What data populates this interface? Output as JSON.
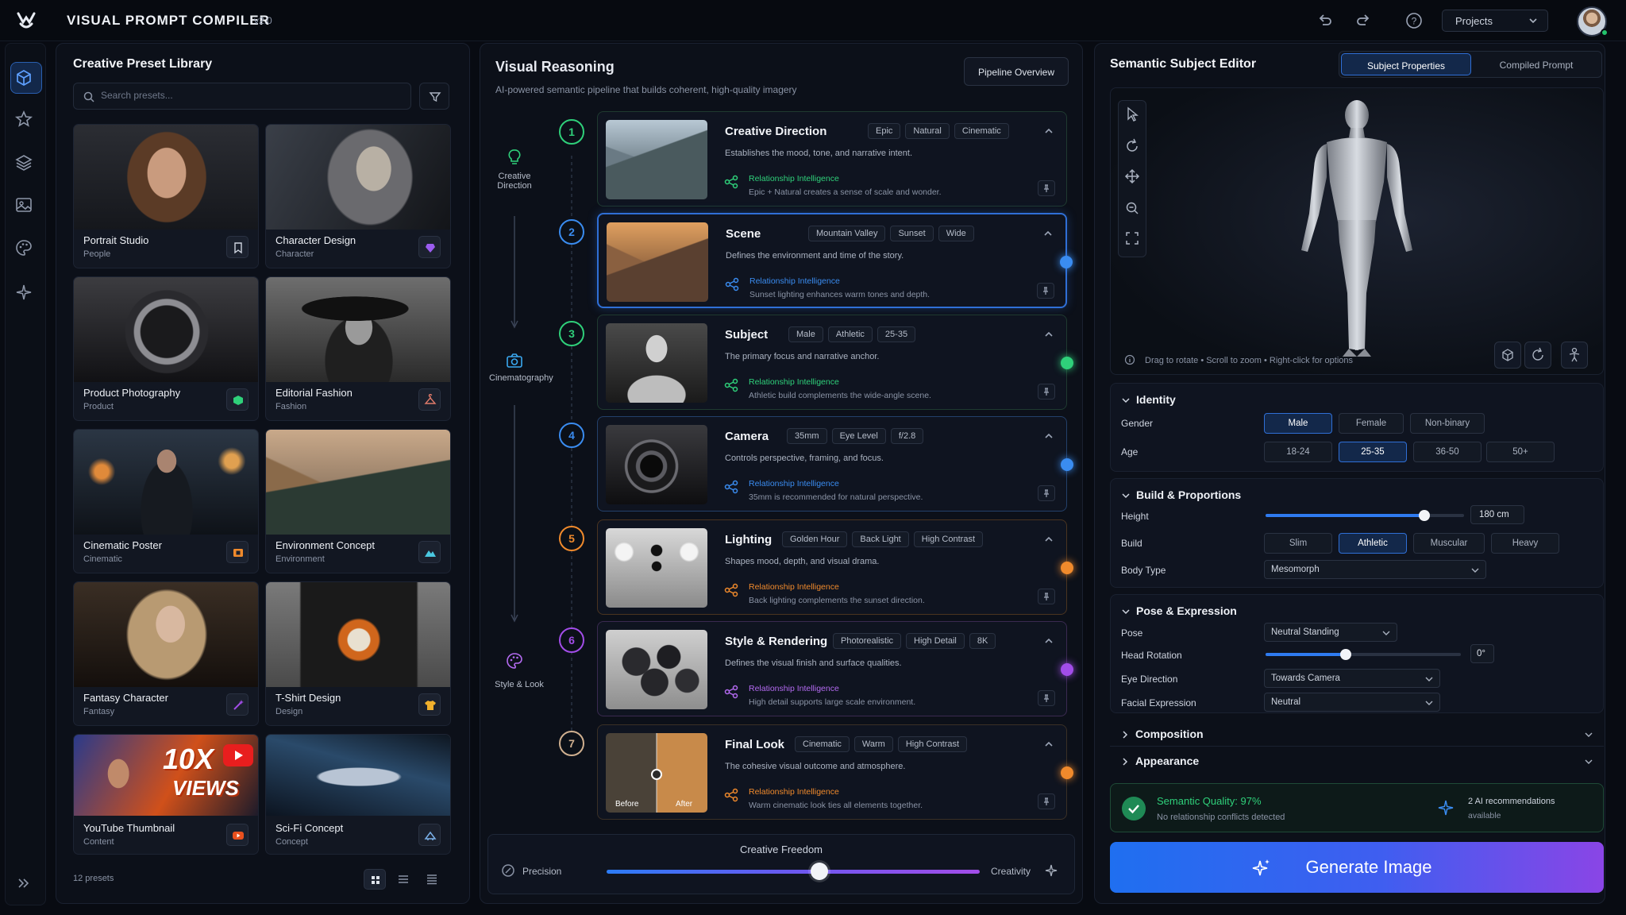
{
  "app": {
    "name": "VISUAL PROMPT COMPILER",
    "version": "v2.0",
    "projects_label": "Projects"
  },
  "icons": {
    "logo": "brand-logo-icon",
    "undo": "undo-icon",
    "redo": "redo-icon",
    "help": "help-icon",
    "sidebar": [
      "cube-icon",
      "star-icon",
      "layers-icon",
      "image-icon",
      "palette-icon",
      "sparkle-icon",
      "expand-icon"
    ]
  },
  "colors": {
    "accent": "#2f7bf0",
    "success": "#23c26b",
    "orange": "#f08a2c",
    "purple": "#a24de8",
    "green": "#2fd07a"
  },
  "library": {
    "title": "Creative Preset Library",
    "search_placeholder": "Search presets...",
    "count": "12 presets",
    "cards": [
      {
        "title": "Portrait Studio",
        "category": "People"
      },
      {
        "title": "Character Design",
        "category": "Character"
      },
      {
        "title": "Product Photography",
        "category": "Product"
      },
      {
        "title": "Editorial Fashion",
        "category": "Fashion"
      },
      {
        "title": "Cinematic Poster",
        "category": "Cinematic"
      },
      {
        "title": "Environment Concept",
        "category": "Environment"
      },
      {
        "title": "Fantasy Character",
        "category": "Fantasy"
      },
      {
        "title": "T-Shirt Design",
        "category": "Design"
      },
      {
        "title": "YouTube Thumbnail",
        "category": "Content"
      },
      {
        "title": "Sci-Fi Concept",
        "category": "Concept"
      }
    ],
    "thumb_text": {
      "line1": "10X",
      "line2": "VIEWS"
    }
  },
  "reasoning": {
    "title": "Visual Reasoning",
    "subtitle": "AI-powered semantic pipeline that builds coherent, high-quality imagery",
    "pipeline_button": "Pipeline Overview",
    "groups": [
      "Creative Direction",
      "Cinematography",
      "Style & Look"
    ],
    "rel_label": "Relationship Intelligence",
    "stages": [
      {
        "num": "1",
        "title": "Creative Direction",
        "chips": [
          "Epic",
          "Natural",
          "Cinematic"
        ],
        "desc": "Establishes the mood, tone, and narrative intent.",
        "rel": "Epic + Natural creates a sense of scale and wonder."
      },
      {
        "num": "2",
        "title": "Scene",
        "chips": [
          "Mountain Valley",
          "Sunset",
          "Wide"
        ],
        "desc": "Defines the environment and time of the story.",
        "rel": "Sunset lighting enhances warm tones and depth."
      },
      {
        "num": "3",
        "title": "Subject",
        "chips": [
          "Male",
          "Athletic",
          "25-35"
        ],
        "desc": "The primary focus and narrative anchor.",
        "rel": "Athletic build complements the wide-angle scene."
      },
      {
        "num": "4",
        "title": "Camera",
        "chips": [
          "35mm",
          "Eye Level",
          "f/2.8"
        ],
        "desc": "Controls perspective, framing, and focus.",
        "rel": "35mm is recommended for natural perspective."
      },
      {
        "num": "5",
        "title": "Lighting",
        "chips": [
          "Golden Hour",
          "Back Light",
          "High Contrast"
        ],
        "desc": "Shapes mood, depth, and visual drama.",
        "rel": "Back lighting complements the sunset direction."
      },
      {
        "num": "6",
        "title": "Style & Rendering",
        "chips": [
          "Photorealistic",
          "High Detail",
          "8K"
        ],
        "desc": "Defines the visual finish and surface qualities.",
        "rel": "High detail supports large scale environment."
      },
      {
        "num": "7",
        "title": "Final Look",
        "chips": [
          "Cinematic",
          "Warm",
          "High Contrast"
        ],
        "desc": "The cohesive visual outcome and atmosphere.",
        "rel": "Warm cinematic look ties all elements together."
      }
    ],
    "before_label": "Before",
    "after_label": "After",
    "freedom": {
      "title": "Creative Freedom",
      "left": "Precision",
      "right": "Creativity",
      "value": 0.57
    }
  },
  "editor": {
    "title": "Semantic Subject Editor",
    "tabs": [
      "Subject Properties",
      "Compiled Prompt"
    ],
    "viewport_hint": "Drag to rotate  •  Scroll to zoom  •  Right-click for options",
    "identity": {
      "title": "Identity",
      "gender_label": "Gender",
      "genders": [
        "Male",
        "Female",
        "Non-binary"
      ],
      "gender_selected": "Male",
      "age_label": "Age",
      "ages": [
        "18-24",
        "25-35",
        "36-50",
        "50+"
      ],
      "age_selected": "25-35"
    },
    "build": {
      "title": "Build & Proportions",
      "height_label": "Height",
      "height_value": "180 cm",
      "height_fraction": 0.8,
      "build_label": "Build",
      "builds": [
        "Slim",
        "Athletic",
        "Muscular",
        "Heavy"
      ],
      "build_selected": "Athletic",
      "body_type_label": "Body Type",
      "body_type": "Mesomorph"
    },
    "pose": {
      "title": "Pose & Expression",
      "pose_label": "Pose",
      "pose": "Neutral Standing",
      "head_label": "Head Rotation",
      "head_value": "0°",
      "head_fraction": 0.41,
      "eye_label": "Eye Direction",
      "eye": "Towards Camera",
      "face_label": "Facial Expression",
      "face": "Neutral"
    },
    "composition": "Composition",
    "appearance": "Appearance",
    "quality": {
      "title": "Semantic Quality: 97%",
      "sub": "No relationship conflicts detected",
      "ai": "2 AI recommendations",
      "ai_sub": "available"
    },
    "generate": "Generate Image"
  }
}
